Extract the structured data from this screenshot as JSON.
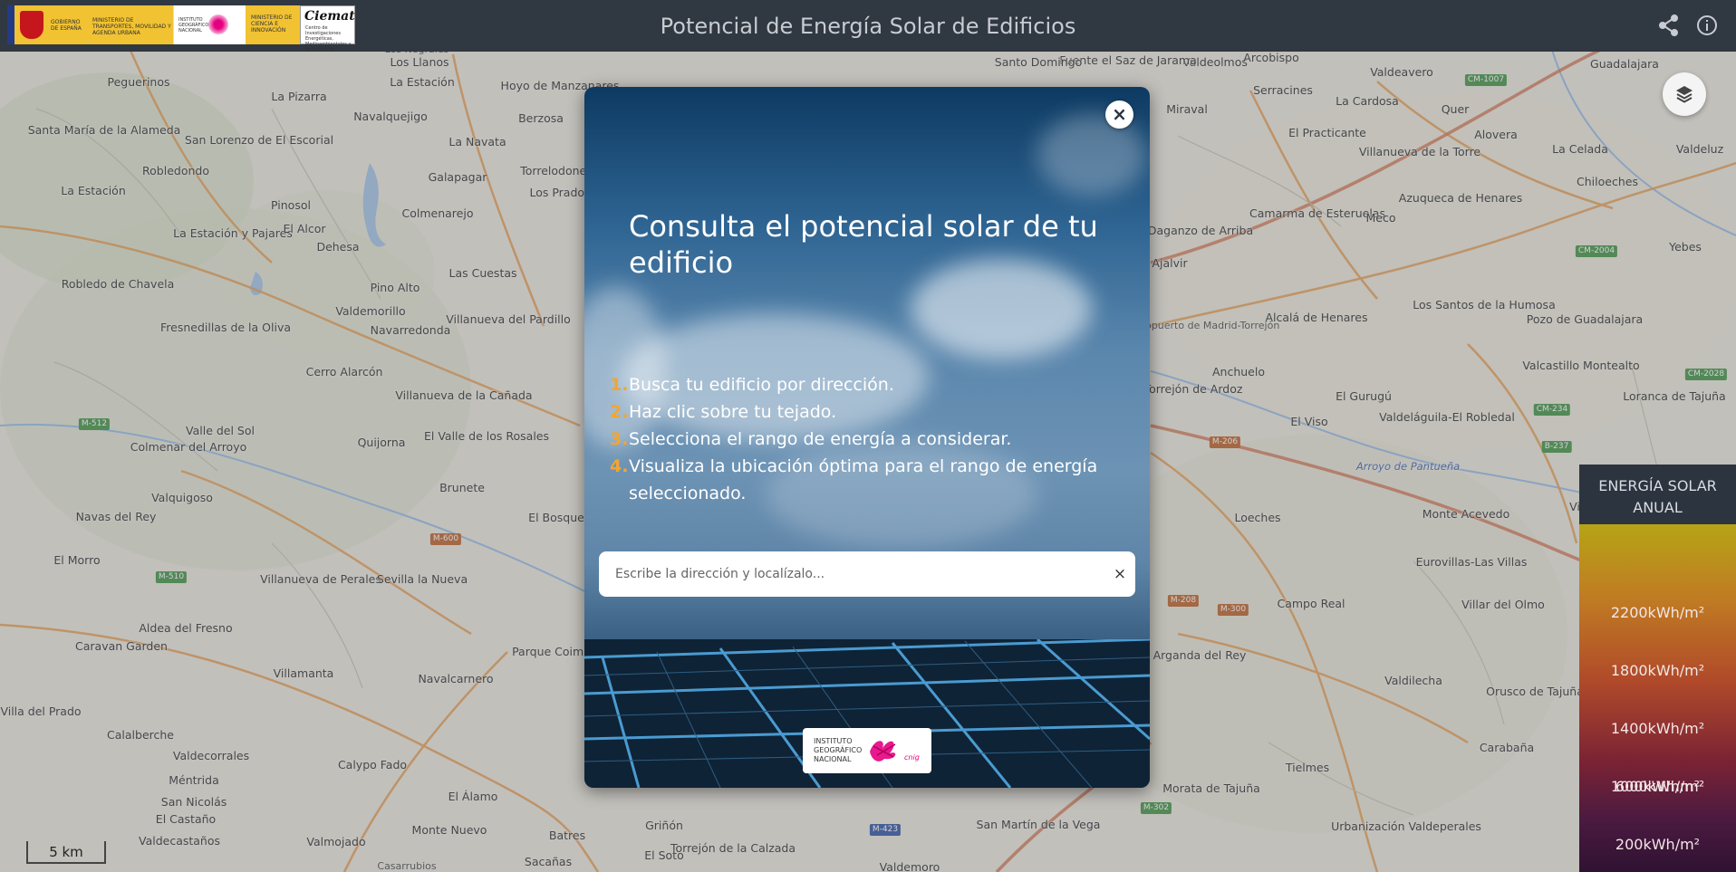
{
  "header": {
    "title": "Potencial de Energía Solar de Edificios",
    "logos": {
      "gobierno": "GOBIERNO DE ESPAÑA",
      "ministerio": "MINISTERIO DE TRANSPORTES, MOVILIDAD Y AGENDA URBANA",
      "ign": "INSTITUTO GEOGRÁFICO NACIONAL",
      "ministerio_ciencia": "MINISTERIO DE CIENCIA E INNOVACIÓN",
      "ciemat": "Ciemat",
      "ciemat_sub": "Centro de Investigaciones Energéticas, Medioambientales y Tecnológicas"
    },
    "icons": [
      "share-icon",
      "info-icon"
    ]
  },
  "modal": {
    "title": "Consulta el potencial solar de tu edificio",
    "steps": [
      {
        "num": "1.",
        "text": "Busca tu edificio por dirección."
      },
      {
        "num": "2.",
        "text": "Haz clic sobre tu tejado."
      },
      {
        "num": "3.",
        "text": "Selecciona el rango de energía a considerar."
      },
      {
        "num": "4.",
        "text": "Visualiza la ubicación óptima para el rango de energía seleccionado."
      }
    ],
    "search": {
      "placeholder": "Escribe la dirección y localízalo...",
      "value": ""
    },
    "close_symbol": "×",
    "clear_symbol": "×",
    "badge": {
      "line1": "INSTITUTO",
      "line2": "GEOGRÁFICO",
      "line3": "NACIONAL",
      "mark": "cnig"
    }
  },
  "legend": {
    "title": "ENERGÍA SOLAR ANUAL",
    "labels": [
      "2200kWh/m²",
      "1800kWh/m²",
      "1400kWh/m²",
      "1000kWh/m²",
      "600kWh/m²",
      "200kWh/m²"
    ],
    "colors": [
      "#b6a416",
      "#c07a23",
      "#b04a2a",
      "#7b2334",
      "#4b1a40",
      "#2f1233"
    ]
  },
  "scalebar": {
    "label": "5 km"
  },
  "map": {
    "places": [
      "Peguerinos",
      "La Pizarra",
      "La Estación",
      "Los Llanos",
      "Los Negrales",
      "Hoyo de Manzanares",
      "Santa María de la Alameda",
      "San Lorenzo de El Escorial",
      "La Navata",
      "Navalquejigo",
      "Berzosa",
      "Robledondo",
      "Galapagar",
      "Torrelodones",
      "La Estación",
      "Pinosol",
      "Colmenarejo",
      "La Estación y Pajares",
      "El Alcor",
      "Dehesa",
      "Los Prados",
      "Las Cuestas",
      "Robledo de Chavela",
      "Pino Alto",
      "Valdemorillo",
      "Fresnedillas de la Oliva",
      "Navarredonda",
      "Villanueva del Pardillo",
      "Cerro Alarcón",
      "Villanueva de la Cañada",
      "El Valle de los Rosales",
      "Valle del Sol",
      "Colmenar del Arroyo",
      "Quijorna",
      "Brunete",
      "Valquigoso",
      "Navas del Rey",
      "El Bosque",
      "El Morro",
      "Villanueva de Perales",
      "Sevilla la Nueva",
      "Aldea del Fresno",
      "Caravan Garden",
      "Villamanta",
      "Navalcarnero",
      "Parque Coimbra",
      "Villa del Prado",
      "Calalberche",
      "Valdecorrales",
      "Calypo Fado",
      "Méntrida",
      "San Nicolás",
      "El Castaño",
      "El Álamo",
      "Monte Nuevo",
      "Valdecastaños",
      "Valmojado",
      "Batres",
      "Griñón",
      "Torrejón de la Calzada",
      "El Soto",
      "Casarrubios",
      "Sacañas",
      "Valdemoro",
      "San Martín de la Vega",
      "Morata de Tajuña",
      "Urbanización Valdeperales",
      "Tielmes",
      "Carabaña",
      "Valdilecha",
      "Orusco de Tajuña",
      "Villar del Olmo",
      "Campo Real",
      "Arganda del Rey",
      "Eurovillas-Las Villas",
      "Loeches",
      "Monte Acevedo",
      "Villalbilla",
      "Anchuelo",
      "El Gurugú",
      "El Viso",
      "Valdeláguila-El Robledal",
      "Valcastillo Montealto",
      "Loranca de Tajuña",
      "Torrejón de Ardoz",
      "Alcalá de Henares",
      "Aeropuerto de Madrid-Torrejón",
      "Los Santos de la Humosa",
      "Pozo de Guadalajara",
      "Ajalvir",
      "Daganzo de Arriba",
      "Camarma de Esteruelas",
      "Meco",
      "Azuqueca de Henares",
      "Chiloeches",
      "Yebes",
      "Villanueva de la Torre",
      "Alovera",
      "La Celada",
      "Valdeluz",
      "El Practicante",
      "Miraval",
      "La Cardosa",
      "Quer",
      "Serracines",
      "Valdeolmos",
      "Fuente el Saz de Jarama",
      "Arcobispo",
      "Valdeavero",
      "Guadalajara",
      "Santo Domingo"
    ],
    "water": [
      "Arroyo de Pantueña"
    ],
    "roads": [
      "M-512",
      "M-510",
      "M-600",
      "CM-1007",
      "CM-2004",
      "CM-2028",
      "CM-234",
      "B-237",
      "M-206",
      "M-208",
      "M-300",
      "M-302",
      "M-423"
    ]
  }
}
